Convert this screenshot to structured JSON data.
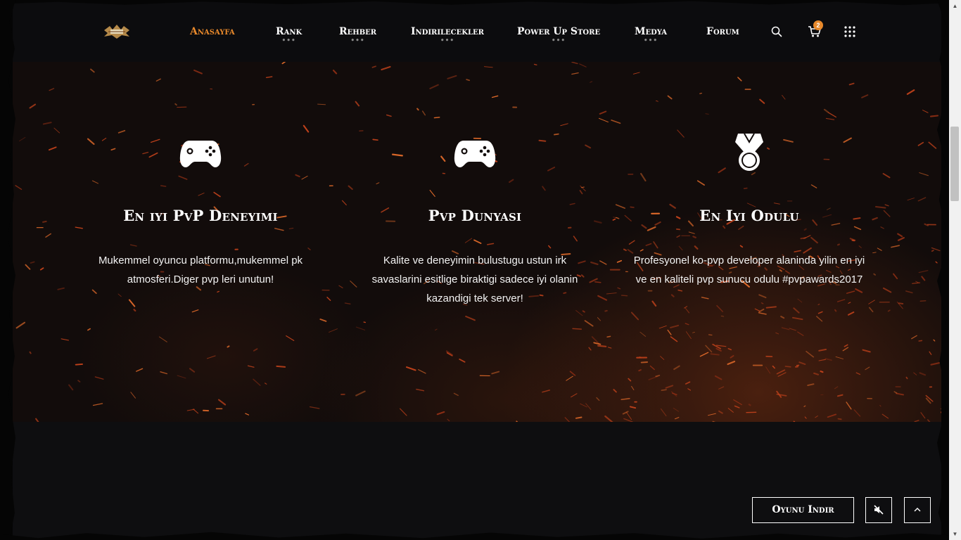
{
  "header": {
    "nav": [
      {
        "label": "Anasayfa",
        "active": true,
        "has_dropdown": false
      },
      {
        "label": "Rank",
        "active": false,
        "has_dropdown": true
      },
      {
        "label": "Rehber",
        "active": false,
        "has_dropdown": true
      },
      {
        "label": "Indirilecekler",
        "active": false,
        "has_dropdown": true
      },
      {
        "label": "Power Up Store",
        "active": false,
        "has_dropdown": true
      },
      {
        "label": "Medya",
        "active": false,
        "has_dropdown": true
      },
      {
        "label": "Forum",
        "active": false,
        "has_dropdown": false
      }
    ],
    "dropdown_indicator": "•••",
    "cart_count": "2",
    "icons": {
      "search": "search-icon",
      "cart": "cart-icon",
      "apps": "apps-grid-icon",
      "logo": "logo-emblem"
    }
  },
  "features": [
    {
      "icon": "gamepad-icon",
      "title": "En iyi PvP Deneyimi",
      "text": "Mukemmel oyuncu platformu,mukemmel pk atmosferi.Diger pvp leri unutun!"
    },
    {
      "icon": "gamepad-icon",
      "title": "Pvp Dunyasi",
      "text": "Kalite ve deneyimin bulustugu ustun irk savaslarini esitlige biraktigi sadece iyi olanin kazandigi tek server!"
    },
    {
      "icon": "medal-icon",
      "title": "En Iyi Odulu",
      "text": "Profesyonel ko-pvp developer alaninda yilin en iyi ve en kaliteli pvp sunucu odulu #pvpawards2017"
    }
  ],
  "footer_controls": {
    "download_label": "Oyunu Indir",
    "mute_icon": "volume-mute-icon",
    "top_icon": "chevron-up-icon"
  },
  "colors": {
    "accent": "#e8892b",
    "background": "#0e0e10",
    "text": "#ffffff"
  }
}
